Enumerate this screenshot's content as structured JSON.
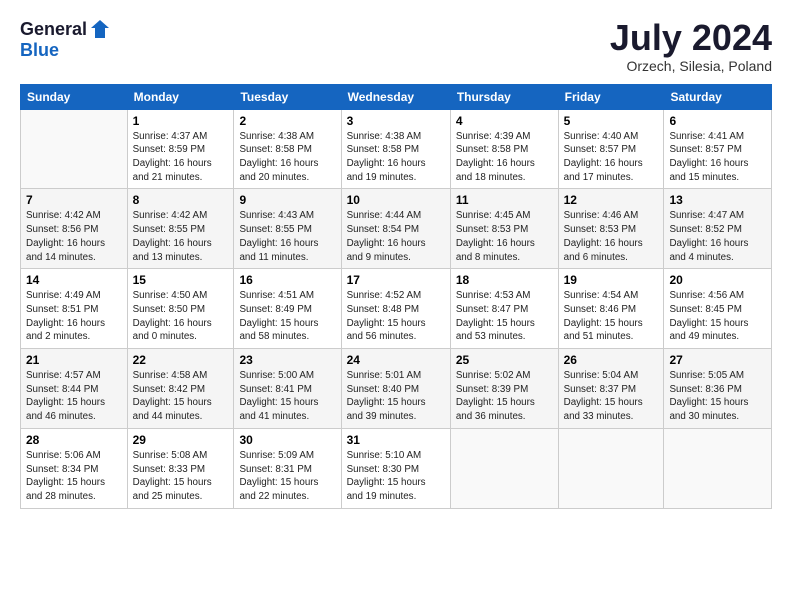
{
  "header": {
    "logo_general": "General",
    "logo_blue": "Blue",
    "title": "July 2024",
    "location": "Orzech, Silesia, Poland"
  },
  "days_of_week": [
    "Sunday",
    "Monday",
    "Tuesday",
    "Wednesday",
    "Thursday",
    "Friday",
    "Saturday"
  ],
  "weeks": [
    [
      {
        "day": "",
        "text": ""
      },
      {
        "day": "1",
        "text": "Sunrise: 4:37 AM\nSunset: 8:59 PM\nDaylight: 16 hours\nand 21 minutes."
      },
      {
        "day": "2",
        "text": "Sunrise: 4:38 AM\nSunset: 8:58 PM\nDaylight: 16 hours\nand 20 minutes."
      },
      {
        "day": "3",
        "text": "Sunrise: 4:38 AM\nSunset: 8:58 PM\nDaylight: 16 hours\nand 19 minutes."
      },
      {
        "day": "4",
        "text": "Sunrise: 4:39 AM\nSunset: 8:58 PM\nDaylight: 16 hours\nand 18 minutes."
      },
      {
        "day": "5",
        "text": "Sunrise: 4:40 AM\nSunset: 8:57 PM\nDaylight: 16 hours\nand 17 minutes."
      },
      {
        "day": "6",
        "text": "Sunrise: 4:41 AM\nSunset: 8:57 PM\nDaylight: 16 hours\nand 15 minutes."
      }
    ],
    [
      {
        "day": "7",
        "text": "Sunrise: 4:42 AM\nSunset: 8:56 PM\nDaylight: 16 hours\nand 14 minutes."
      },
      {
        "day": "8",
        "text": "Sunrise: 4:42 AM\nSunset: 8:55 PM\nDaylight: 16 hours\nand 13 minutes."
      },
      {
        "day": "9",
        "text": "Sunrise: 4:43 AM\nSunset: 8:55 PM\nDaylight: 16 hours\nand 11 minutes."
      },
      {
        "day": "10",
        "text": "Sunrise: 4:44 AM\nSunset: 8:54 PM\nDaylight: 16 hours\nand 9 minutes."
      },
      {
        "day": "11",
        "text": "Sunrise: 4:45 AM\nSunset: 8:53 PM\nDaylight: 16 hours\nand 8 minutes."
      },
      {
        "day": "12",
        "text": "Sunrise: 4:46 AM\nSunset: 8:53 PM\nDaylight: 16 hours\nand 6 minutes."
      },
      {
        "day": "13",
        "text": "Sunrise: 4:47 AM\nSunset: 8:52 PM\nDaylight: 16 hours\nand 4 minutes."
      }
    ],
    [
      {
        "day": "14",
        "text": "Sunrise: 4:49 AM\nSunset: 8:51 PM\nDaylight: 16 hours\nand 2 minutes."
      },
      {
        "day": "15",
        "text": "Sunrise: 4:50 AM\nSunset: 8:50 PM\nDaylight: 16 hours\nand 0 minutes."
      },
      {
        "day": "16",
        "text": "Sunrise: 4:51 AM\nSunset: 8:49 PM\nDaylight: 15 hours\nand 58 minutes."
      },
      {
        "day": "17",
        "text": "Sunrise: 4:52 AM\nSunset: 8:48 PM\nDaylight: 15 hours\nand 56 minutes."
      },
      {
        "day": "18",
        "text": "Sunrise: 4:53 AM\nSunset: 8:47 PM\nDaylight: 15 hours\nand 53 minutes."
      },
      {
        "day": "19",
        "text": "Sunrise: 4:54 AM\nSunset: 8:46 PM\nDaylight: 15 hours\nand 51 minutes."
      },
      {
        "day": "20",
        "text": "Sunrise: 4:56 AM\nSunset: 8:45 PM\nDaylight: 15 hours\nand 49 minutes."
      }
    ],
    [
      {
        "day": "21",
        "text": "Sunrise: 4:57 AM\nSunset: 8:44 PM\nDaylight: 15 hours\nand 46 minutes."
      },
      {
        "day": "22",
        "text": "Sunrise: 4:58 AM\nSunset: 8:42 PM\nDaylight: 15 hours\nand 44 minutes."
      },
      {
        "day": "23",
        "text": "Sunrise: 5:00 AM\nSunset: 8:41 PM\nDaylight: 15 hours\nand 41 minutes."
      },
      {
        "day": "24",
        "text": "Sunrise: 5:01 AM\nSunset: 8:40 PM\nDaylight: 15 hours\nand 39 minutes."
      },
      {
        "day": "25",
        "text": "Sunrise: 5:02 AM\nSunset: 8:39 PM\nDaylight: 15 hours\nand 36 minutes."
      },
      {
        "day": "26",
        "text": "Sunrise: 5:04 AM\nSunset: 8:37 PM\nDaylight: 15 hours\nand 33 minutes."
      },
      {
        "day": "27",
        "text": "Sunrise: 5:05 AM\nSunset: 8:36 PM\nDaylight: 15 hours\nand 30 minutes."
      }
    ],
    [
      {
        "day": "28",
        "text": "Sunrise: 5:06 AM\nSunset: 8:34 PM\nDaylight: 15 hours\nand 28 minutes."
      },
      {
        "day": "29",
        "text": "Sunrise: 5:08 AM\nSunset: 8:33 PM\nDaylight: 15 hours\nand 25 minutes."
      },
      {
        "day": "30",
        "text": "Sunrise: 5:09 AM\nSunset: 8:31 PM\nDaylight: 15 hours\nand 22 minutes."
      },
      {
        "day": "31",
        "text": "Sunrise: 5:10 AM\nSunset: 8:30 PM\nDaylight: 15 hours\nand 19 minutes."
      },
      {
        "day": "",
        "text": ""
      },
      {
        "day": "",
        "text": ""
      },
      {
        "day": "",
        "text": ""
      }
    ]
  ]
}
